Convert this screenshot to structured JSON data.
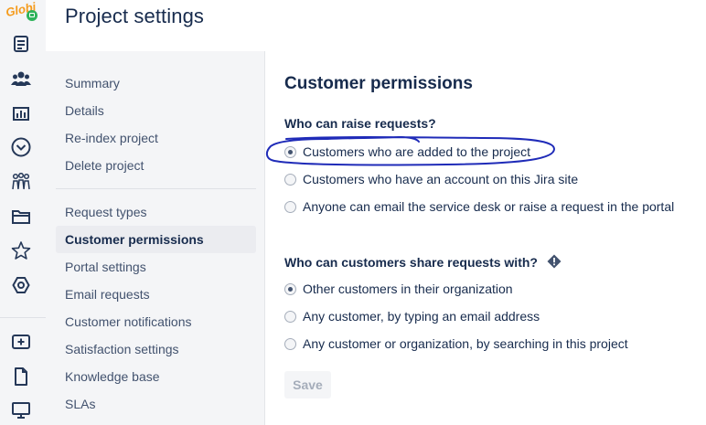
{
  "app": {
    "logo_text": "Globi"
  },
  "global_nav": {
    "icons": [
      "issues-icon",
      "people-icon",
      "reports-icon",
      "circle-chevron-icon",
      "team-icon",
      "folder-icon",
      "star-icon",
      "hexagon-icon",
      "add-icon",
      "page-icon",
      "monitor-icon"
    ]
  },
  "header": {
    "title": "Project settings"
  },
  "settings_nav": {
    "group1": [
      "Summary",
      "Details",
      "Re-index project",
      "Delete project"
    ],
    "group2": [
      "Request types",
      "Customer permissions",
      "Portal settings",
      "Email requests",
      "Customer notifications",
      "Satisfaction settings",
      "Knowledge base",
      "SLAs"
    ],
    "active": "Customer permissions"
  },
  "main": {
    "section_title": "Customer permissions",
    "raise_requests": {
      "label": "Who can raise requests?",
      "options": [
        {
          "label": "Customers who are added to the project",
          "checked": true
        },
        {
          "label": "Customers who have an account on this Jira site",
          "checked": false
        },
        {
          "label": "Anyone can email the service desk or raise a request in the portal",
          "checked": false
        }
      ]
    },
    "share_requests": {
      "label": "Who can customers share requests with?",
      "options": [
        {
          "label": "Other customers in their organization",
          "checked": true
        },
        {
          "label": "Any customer, by typing an email address",
          "checked": false
        },
        {
          "label": "Any customer or organization, by searching in this project",
          "checked": false
        }
      ]
    },
    "save_label": "Save"
  },
  "colors": {
    "annotation": "#1f2bb8",
    "nav_bg": "#f4f5f7",
    "text": "#172b4d"
  }
}
